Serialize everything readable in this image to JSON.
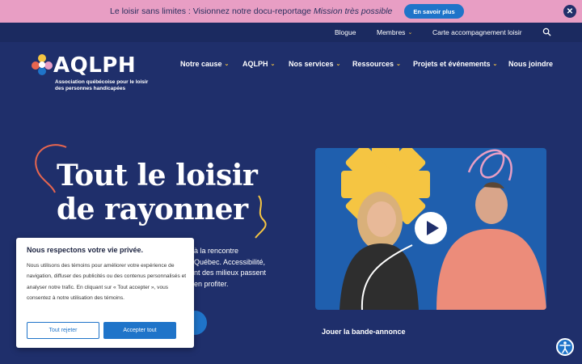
{
  "banner": {
    "text_main": "Le loisir sans limites : Visionnez notre docu-reportage ",
    "text_italic": "Mission très possible",
    "button_label": "En savoir plus",
    "close_symbol": "✕"
  },
  "subnav": {
    "items": [
      {
        "label": "Blogue",
        "has_dropdown": false
      },
      {
        "label": "Membres",
        "has_dropdown": true
      },
      {
        "label": "Carte accompagnement loisir",
        "has_dropdown": false
      }
    ],
    "search_icon": "search-icon"
  },
  "logo": {
    "word": "AQLPH",
    "subtitle": "Association québécoise pour le loisir des personnes handicapées"
  },
  "mainnav": {
    "items": [
      {
        "label": "Notre cause",
        "has_dropdown": true
      },
      {
        "label": "AQLPH",
        "has_dropdown": true
      },
      {
        "label": "Nos services",
        "has_dropdown": true
      },
      {
        "label": "Ressources",
        "has_dropdown": true
      },
      {
        "label": "Projets et événements",
        "has_dropdown": true
      },
      {
        "label": "Nous joindre",
        "has_dropdown": false
      }
    ],
    "chevron": "⌄"
  },
  "hero": {
    "title_line1": "Tout le loisir",
    "title_line2": "de rayonner",
    "desc_line1": "à la rencontre",
    "desc_line2": "Québec. Accessibilité,",
    "desc_line3": "nt des milieux passent",
    "desc_line4": "en profiter."
  },
  "video": {
    "caption": "Jouer la bande-annonce",
    "play_icon": "play-icon"
  },
  "cookie": {
    "title": "Nous respectons votre vie privée.",
    "body": "Nous utilisons des témoins pour améliorer votre expérience de navigation, diffuser des publicités ou des contenus personnalisés et analyser notre trafic. En cliquant sur « Tout accepter », vous consentez à notre utilisation des témoins.",
    "reject_label": "Tout rejeter",
    "accept_label": "Accepter tout"
  },
  "accessibility": {
    "icon": "accessibility-icon"
  },
  "colors": {
    "background": "#1f2f6b",
    "banner": "#e89ec4",
    "accent_blue": "#1f74c9",
    "yellow": "#f5c542",
    "coral": "#e8664f",
    "pink": "#e89ec4"
  }
}
